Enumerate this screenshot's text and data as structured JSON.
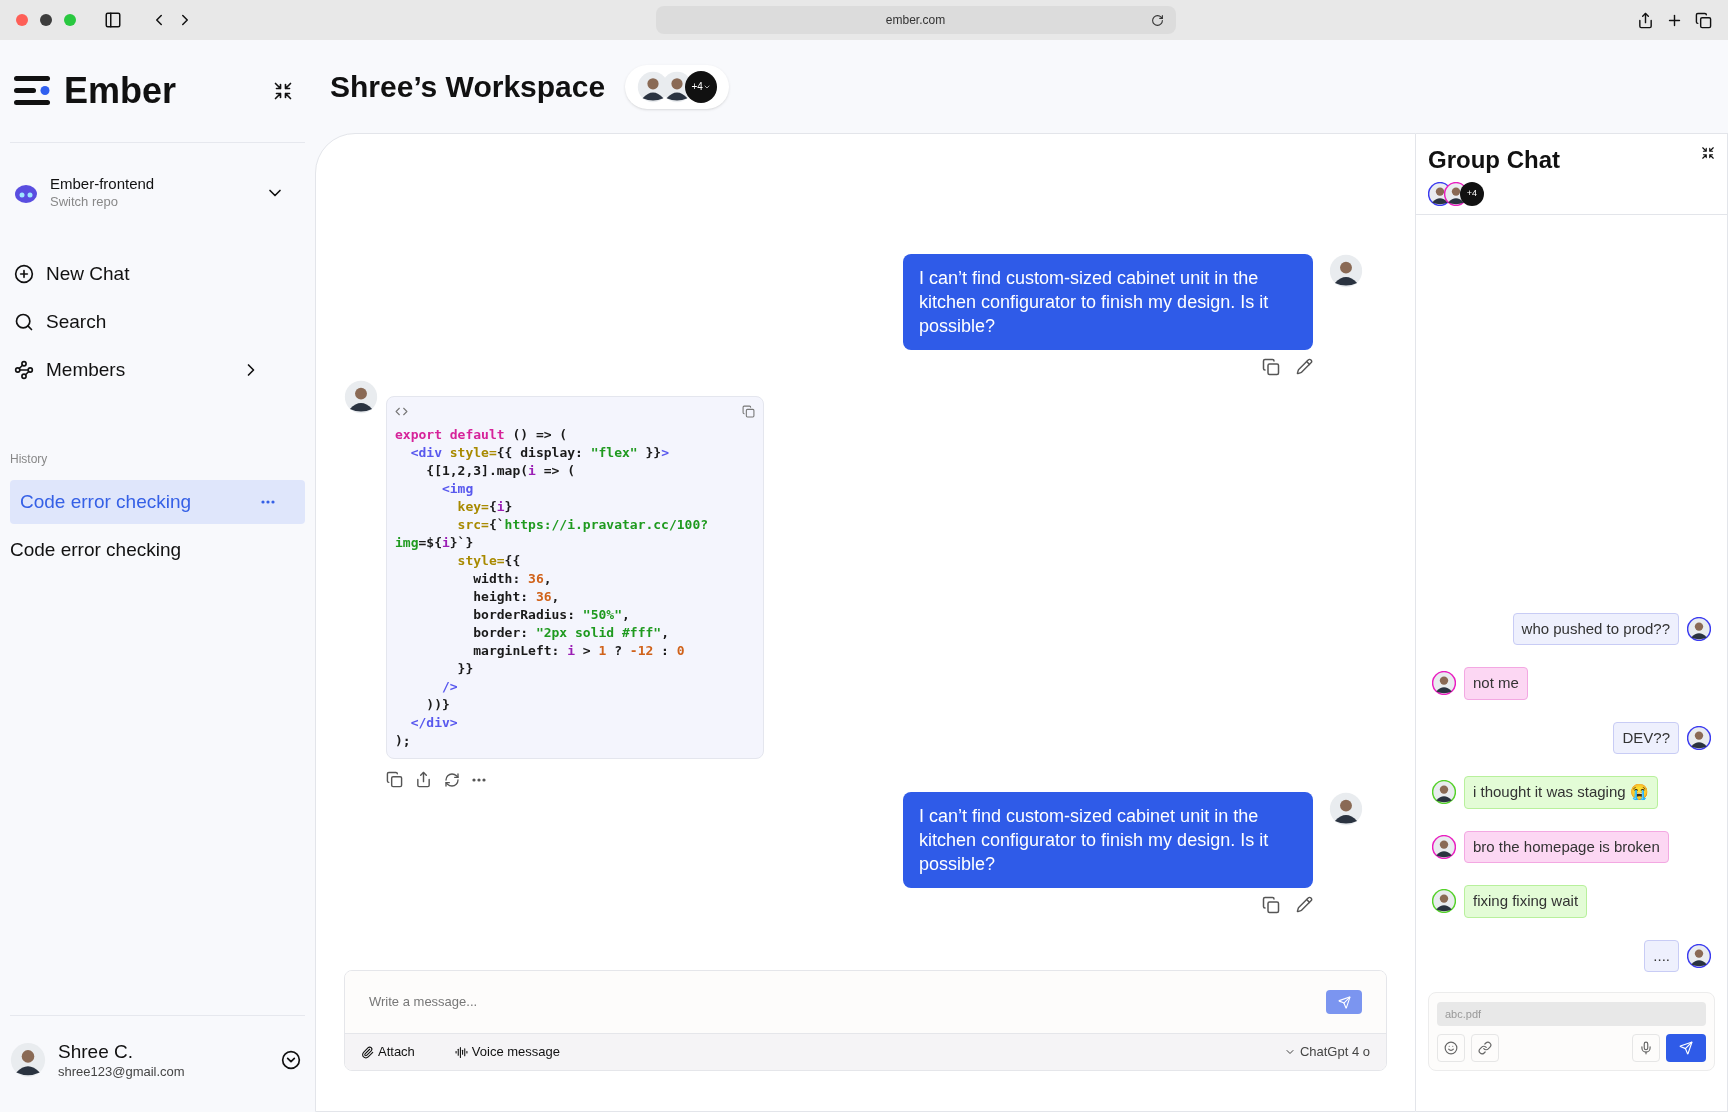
{
  "browser": {
    "url": "ember.com"
  },
  "sidebar": {
    "logo": "Ember",
    "repo": {
      "name": "Ember-frontend",
      "hint": "Switch repo"
    },
    "nav": [
      {
        "label": "New Chat",
        "kind": "new"
      },
      {
        "label": "Search",
        "kind": "search"
      },
      {
        "label": "Members",
        "kind": "members"
      }
    ],
    "history_label": "History",
    "history": [
      {
        "label": "Code error checking",
        "selected": true
      },
      {
        "label": "Code error checking",
        "selected": false
      }
    ],
    "user": {
      "name": "Shree C.",
      "email": "shree123@gmail.com"
    }
  },
  "header": {
    "title": "Shree’s Workspace",
    "more_members": "+4"
  },
  "chat": [
    {
      "kind": "user",
      "text": "I can’t find custom-sized cabinet unit in the kitchen configurator to finish my design. Is it possible?"
    },
    {
      "kind": "code",
      "lines": [
        [
          {
            "t": "export default",
            "color": "#d6239a"
          },
          {
            "t": " () => (",
            "color": "#1a1a1a"
          }
        ],
        [
          {
            "t": "  <div",
            "color": "#5858ee"
          },
          {
            "t": " style=",
            "color": "#a88a00"
          },
          {
            "t": "{{ display: ",
            "color": "#1a1a1a"
          },
          {
            "t": "\"flex\"",
            "color": "#1f9a1f"
          },
          {
            "t": " }}",
            "color": "#1a1a1a"
          },
          {
            "t": ">",
            "color": "#5858ee"
          }
        ],
        [
          {
            "t": "    {[1,2,3].map(",
            "color": "#1a1a1a"
          },
          {
            "t": "i",
            "color": "#9b1fb5"
          },
          {
            "t": " => (",
            "color": "#1a1a1a"
          }
        ],
        [
          {
            "t": "      <img",
            "color": "#5858ee"
          }
        ],
        [
          {
            "t": "        key=",
            "color": "#a88a00"
          },
          {
            "t": "{",
            "color": "#1a1a1a"
          },
          {
            "t": "i",
            "color": "#9b1fb5"
          },
          {
            "t": "}",
            "color": "#1a1a1a"
          }
        ],
        [
          {
            "t": "        src=",
            "color": "#a88a00"
          },
          {
            "t": "{`",
            "color": "#1a1a1a"
          },
          {
            "t": "https://i.pravatar.cc/100?",
            "color": "#1f9a1f"
          }
        ],
        [
          {
            "t": "img",
            "color": "#1f9a1f"
          },
          {
            "t": "=${",
            "color": "#1a1a1a"
          },
          {
            "t": "i",
            "color": "#9b1fb5"
          },
          {
            "t": "}`}",
            "color": "#1a1a1a"
          }
        ],
        [
          {
            "t": "        style=",
            "color": "#a88a00"
          },
          {
            "t": "{{",
            "color": "#1a1a1a"
          }
        ],
        [
          {
            "t": "          width: ",
            "color": "#1a1a1a"
          },
          {
            "t": "36",
            "color": "#d0621a"
          },
          {
            "t": ",",
            "color": "#1a1a1a"
          }
        ],
        [
          {
            "t": "          height: ",
            "color": "#1a1a1a"
          },
          {
            "t": "36",
            "color": "#d0621a"
          },
          {
            "t": ",",
            "color": "#1a1a1a"
          }
        ],
        [
          {
            "t": "          borderRadius: ",
            "color": "#1a1a1a"
          },
          {
            "t": "\"50%\"",
            "color": "#1f9a1f"
          },
          {
            "t": ",",
            "color": "#1a1a1a"
          }
        ],
        [
          {
            "t": "          border: ",
            "color": "#1a1a1a"
          },
          {
            "t": "\"2px solid #fff\"",
            "color": "#1f9a1f"
          },
          {
            "t": ",",
            "color": "#1a1a1a"
          }
        ],
        [
          {
            "t": "          marginLeft: ",
            "color": "#1a1a1a"
          },
          {
            "t": "i",
            "color": "#9b1fb5"
          },
          {
            "t": " > ",
            "color": "#1a1a1a"
          },
          {
            "t": "1",
            "color": "#d0621a"
          },
          {
            "t": " ? ",
            "color": "#1a1a1a"
          },
          {
            "t": "-12",
            "color": "#d0621a"
          },
          {
            "t": " : ",
            "color": "#1a1a1a"
          },
          {
            "t": "0",
            "color": "#d0621a"
          }
        ],
        [
          {
            "t": "        }}",
            "color": "#1a1a1a"
          }
        ],
        [
          {
            "t": "      />",
            "color": "#5858ee"
          }
        ],
        [
          {
            "t": "    ))}",
            "color": "#1a1a1a"
          }
        ],
        [
          {
            "t": "  </div>",
            "color": "#5858ee"
          }
        ],
        [
          {
            "t": ");",
            "color": "#1a1a1a"
          }
        ]
      ]
    },
    {
      "kind": "user",
      "text": "I can’t find custom-sized cabinet unit in the kitchen configurator to finish my design. Is it possible?"
    }
  ],
  "composer": {
    "placeholder": "Write a message...",
    "attach": "Attach",
    "voice": "Voice message",
    "model": "ChatGpt 4 o"
  },
  "group_chat": {
    "title": "Group Chat",
    "more_members": "+4",
    "messages": [
      {
        "text": "who pushed to prod??",
        "mine": true,
        "color": "#eef0fd"
      },
      {
        "text": "not me",
        "mine": false,
        "color": "#fcd7f3"
      },
      {
        "text": "DEV??",
        "mine": true,
        "color": "#eef0fd"
      },
      {
        "text": "i thought it was staging 😭",
        "mine": false,
        "color": "#e3fcd6"
      },
      {
        "text": "bro the homepage is broken",
        "mine": false,
        "color": "#fcd7f3"
      },
      {
        "text": "fixing fixing wait",
        "mine": false,
        "color": "#e3fcd6"
      },
      {
        "text": "....",
        "mine": true,
        "color": "#eef0fd"
      }
    ],
    "input_placeholder": "abc.pdf"
  }
}
